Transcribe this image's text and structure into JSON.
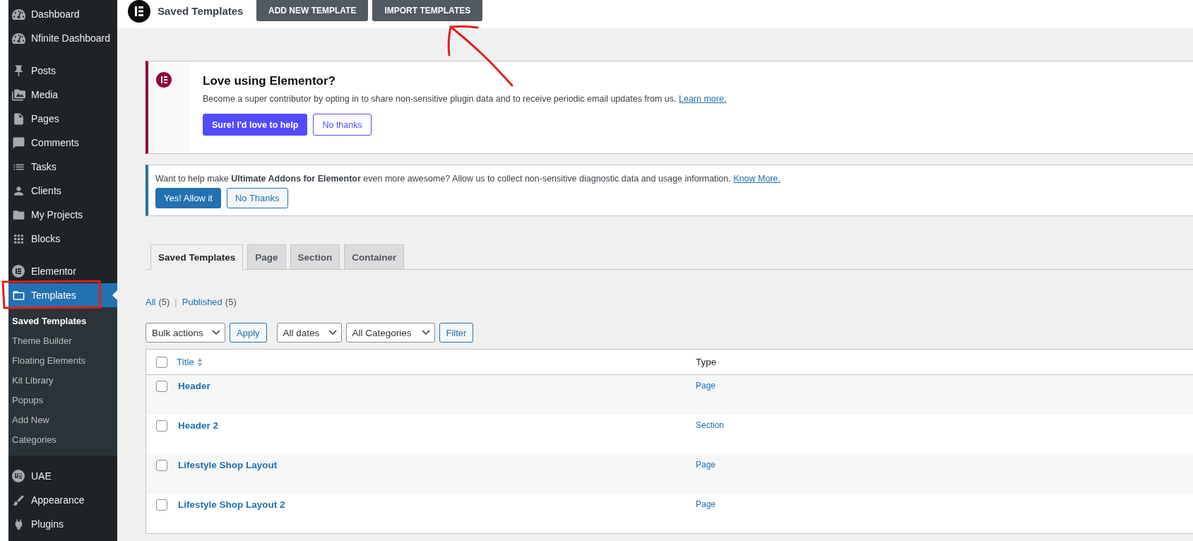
{
  "sidebar": {
    "groups": [
      {
        "items": [
          {
            "label": "Dashboard",
            "selected": false
          },
          {
            "label": "Nfinite Dashboard",
            "selected": false
          }
        ]
      },
      {
        "items": [
          {
            "label": "Posts",
            "selected": false
          },
          {
            "label": "Media",
            "selected": false
          },
          {
            "label": "Pages",
            "selected": false
          },
          {
            "label": "Comments",
            "selected": false
          },
          {
            "label": "Tasks",
            "selected": false
          },
          {
            "label": "Clients",
            "selected": false
          },
          {
            "label": "My Projects",
            "selected": false
          },
          {
            "label": "Blocks",
            "selected": false
          }
        ]
      },
      {
        "items": [
          {
            "label": "Elementor",
            "selected": false
          },
          {
            "label": "Templates",
            "selected": true,
            "submenu": [
              {
                "label": "Saved Templates",
                "selected": true
              },
              {
                "label": "Theme Builder",
                "selected": false
              },
              {
                "label": "Floating Elements",
                "selected": false
              },
              {
                "label": "Kit Library",
                "selected": false
              },
              {
                "label": "Popups",
                "selected": false
              },
              {
                "label": "Add New",
                "selected": false
              },
              {
                "label": "Categories",
                "selected": false
              }
            ]
          }
        ]
      },
      {
        "items": [
          {
            "label": "UAE",
            "selected": false
          },
          {
            "label": "Appearance",
            "selected": false
          },
          {
            "label": "Plugins",
            "selected": false
          }
        ]
      }
    ]
  },
  "topbar": {
    "title": "Saved Templates",
    "buttons": [
      "ADD NEW TEMPLATE",
      "IMPORT TEMPLATES"
    ]
  },
  "elementor_notice": {
    "title": "Love using Elementor?",
    "text": "Become a super contributor by opting in to share non-sensitive plugin data and to receive periodic email updates from us.",
    "link": "Learn more.",
    "buttons": [
      {
        "label": "Sure! I'd love to help",
        "kind": "primary"
      },
      {
        "label": "No thanks",
        "kind": "secondary"
      }
    ]
  },
  "uae_notice": {
    "text": "Want to help make **Ultimate Addons for Elementor** even more awesome? Allow us to collect non-sensitive diagnostic data and usage information.",
    "link": "Know More.",
    "buttons": [
      {
        "label": "Yes! Allow it",
        "kind": "primary"
      },
      {
        "label": "No Thanks",
        "kind": "secondary"
      }
    ]
  },
  "tabs": [
    {
      "label": "Saved Templates",
      "selected": true
    },
    {
      "label": "Page",
      "selected": false
    },
    {
      "label": "Section",
      "selected": false
    },
    {
      "label": "Container",
      "selected": false
    }
  ],
  "views_separator": "|",
  "views": [
    {
      "label": "All",
      "count": "(5)"
    },
    {
      "label": "Published",
      "count": "(5)"
    }
  ],
  "filters": {
    "bulk_action": "Bulk actions",
    "apply": "Apply",
    "date": "All dates",
    "category": "All Categories",
    "filter": "Filter"
  },
  "table": {
    "select_all": false,
    "columns": [
      "Title",
      "Type"
    ],
    "rows": [
      {
        "title": "Header",
        "type": "Page",
        "checked": false
      },
      {
        "title": "Header 2",
        "type": "Section",
        "checked": false
      },
      {
        "title": "Lifestyle Shop Layout",
        "type": "Page",
        "checked": false
      },
      {
        "title": "Lifestyle Shop Layout 2",
        "type": "Page",
        "checked": false
      }
    ]
  }
}
